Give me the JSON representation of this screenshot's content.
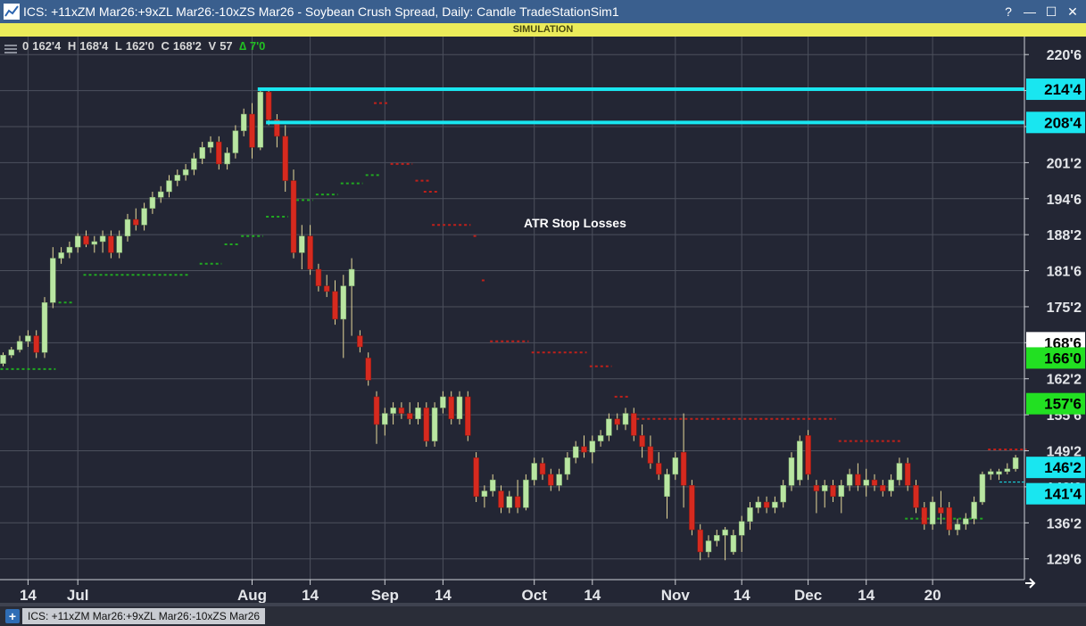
{
  "window": {
    "title": "ICS: +11xZM Mar26:+9xZL Mar26:-10xZS Mar26 - Soybean Crush Spread, Daily: Candle TradeStationSim1",
    "help": "?",
    "minimize": "—",
    "maximize": "☐",
    "close": "✕"
  },
  "banner": {
    "text": "SIMULATION"
  },
  "status": {
    "o_label": "0",
    "o_val": "162'4",
    "h_label": "H",
    "h_val": "168'4",
    "l_label": "L",
    "l_val": "162'0",
    "c_label": "C",
    "c_val": "168'2",
    "v_label": "V",
    "v_val": "57",
    "delta": "∆ 7'0"
  },
  "annotation": "ATR Stop Losses",
  "tab": {
    "label": "ICS: +11xZM Mar26:+9xZL Mar26:-10xZS Mar26",
    "add": "+"
  },
  "colors": {
    "background": "#232634",
    "up": "#b9e6a2",
    "down": "#d62a1f",
    "wick": "#e6d99a",
    "cyan": "#19e6f0",
    "green_marker": "#22e022",
    "stop_long": "#21a821",
    "stop_short": "#c0201a",
    "grid": "#4c505d"
  },
  "chart_data": {
    "type": "candlestick",
    "title": "Soybean Crush Spread, Daily",
    "price_unit": "cents, eighths",
    "ylim": [
      126.0,
      224.0
    ],
    "y_ticks": [
      "129'6",
      "136'2",
      "142'6",
      "149'2",
      "155'6",
      "162'2",
      "168'6",
      "175'2",
      "181'6",
      "188'2",
      "194'6",
      "201'2",
      "207'6",
      "214'2",
      "220'6"
    ],
    "x_tick_labels": [
      {
        "label": "14",
        "bar": 3
      },
      {
        "label": "Jul",
        "bar": 9
      },
      {
        "label": "Aug",
        "bar": 30
      },
      {
        "label": "14",
        "bar": 37
      },
      {
        "label": "Sep",
        "bar": 46
      },
      {
        "label": "14",
        "bar": 53
      },
      {
        "label": "Oct",
        "bar": 64
      },
      {
        "label": "14",
        "bar": 71
      },
      {
        "label": "Nov",
        "bar": 81
      },
      {
        "label": "14",
        "bar": 89
      },
      {
        "label": "Dec",
        "bar": 97
      },
      {
        "label": "14",
        "bar": 104
      },
      {
        "label": "20",
        "bar": 112
      }
    ],
    "horizontal_lines": [
      {
        "value": 214.5,
        "label": "214'4",
        "from_bar": 31
      },
      {
        "value": 208.5,
        "label": "208'4",
        "from_bar": 32
      }
    ],
    "price_markers": [
      {
        "value": 168.75,
        "label": "168'6",
        "style": "white"
      },
      {
        "value": 166.0,
        "label": "166'0",
        "style": "green"
      },
      {
        "value": 157.75,
        "label": "157'6",
        "style": "green"
      },
      {
        "value": 146.25,
        "label": "146'2",
        "style": "cyan"
      },
      {
        "value": 141.5,
        "label": "141'4",
        "style": "cyan"
      }
    ],
    "candles": [
      {
        "o": 165.0,
        "h": 167.0,
        "l": 164.5,
        "c": 166.5
      },
      {
        "o": 166.5,
        "h": 168.0,
        "l": 166.0,
        "c": 167.5
      },
      {
        "o": 167.5,
        "h": 170.0,
        "l": 167.0,
        "c": 169.0
      },
      {
        "o": 169.0,
        "h": 171.0,
        "l": 168.0,
        "c": 170.0
      },
      {
        "o": 170.0,
        "h": 171.0,
        "l": 166.0,
        "c": 167.0
      },
      {
        "o": 167.0,
        "h": 177.0,
        "l": 166.0,
        "c": 176.0
      },
      {
        "o": 176.0,
        "h": 186.0,
        "l": 175.0,
        "c": 184.0
      },
      {
        "o": 184.0,
        "h": 186.0,
        "l": 183.0,
        "c": 185.0
      },
      {
        "o": 185.0,
        "h": 187.0,
        "l": 184.0,
        "c": 186.0
      },
      {
        "o": 186.0,
        "h": 188.5,
        "l": 185.0,
        "c": 188.0
      },
      {
        "o": 188.0,
        "h": 189.0,
        "l": 186.0,
        "c": 186.5
      },
      {
        "o": 186.5,
        "h": 188.0,
        "l": 185.0,
        "c": 187.0
      },
      {
        "o": 187.0,
        "h": 189.0,
        "l": 185.0,
        "c": 188.0
      },
      {
        "o": 188.0,
        "h": 189.0,
        "l": 184.0,
        "c": 185.0
      },
      {
        "o": 185.0,
        "h": 189.0,
        "l": 184.0,
        "c": 188.0
      },
      {
        "o": 188.0,
        "h": 192.0,
        "l": 187.0,
        "c": 191.0
      },
      {
        "o": 191.0,
        "h": 193.0,
        "l": 189.0,
        "c": 190.0
      },
      {
        "o": 190.0,
        "h": 194.0,
        "l": 189.0,
        "c": 193.0
      },
      {
        "o": 193.0,
        "h": 196.0,
        "l": 192.0,
        "c": 195.0
      },
      {
        "o": 195.0,
        "h": 197.0,
        "l": 194.0,
        "c": 196.0
      },
      {
        "o": 196.0,
        "h": 199.0,
        "l": 195.0,
        "c": 198.0
      },
      {
        "o": 198.0,
        "h": 200.0,
        "l": 197.0,
        "c": 199.0
      },
      {
        "o": 199.0,
        "h": 201.0,
        "l": 198.0,
        "c": 200.0
      },
      {
        "o": 200.0,
        "h": 203.0,
        "l": 199.0,
        "c": 202.0
      },
      {
        "o": 202.0,
        "h": 205.0,
        "l": 201.0,
        "c": 204.0
      },
      {
        "o": 204.0,
        "h": 206.0,
        "l": 203.0,
        "c": 205.0
      },
      {
        "o": 205.0,
        "h": 206.0,
        "l": 200.0,
        "c": 201.0
      },
      {
        "o": 201.0,
        "h": 204.0,
        "l": 200.0,
        "c": 203.0
      },
      {
        "o": 203.0,
        "h": 208.0,
        "l": 202.0,
        "c": 207.0
      },
      {
        "o": 207.0,
        "h": 211.0,
        "l": 206.0,
        "c": 210.0
      },
      {
        "o": 210.0,
        "h": 212.0,
        "l": 202.0,
        "c": 204.0
      },
      {
        "o": 204.0,
        "h": 214.5,
        "l": 203.5,
        "c": 214.0
      },
      {
        "o": 214.0,
        "h": 214.5,
        "l": 208.0,
        "c": 209.0
      },
      {
        "o": 209.0,
        "h": 210.0,
        "l": 204.0,
        "c": 206.0
      },
      {
        "o": 206.0,
        "h": 208.0,
        "l": 196.0,
        "c": 198.0
      },
      {
        "o": 198.0,
        "h": 200.0,
        "l": 184.0,
        "c": 185.0
      },
      {
        "o": 185.0,
        "h": 190.0,
        "l": 182.0,
        "c": 188.0
      },
      {
        "o": 188.0,
        "h": 190.0,
        "l": 181.0,
        "c": 182.0
      },
      {
        "o": 182.0,
        "h": 183.0,
        "l": 178.0,
        "c": 179.0
      },
      {
        "o": 179.0,
        "h": 181.0,
        "l": 177.0,
        "c": 178.0
      },
      {
        "o": 178.0,
        "h": 180.0,
        "l": 172.0,
        "c": 173.0
      },
      {
        "o": 173.0,
        "h": 181.0,
        "l": 166.0,
        "c": 179.0
      },
      {
        "o": 179.0,
        "h": 184.0,
        "l": 170.0,
        "c": 182.0
      },
      {
        "o": 170.0,
        "h": 171.0,
        "l": 167.0,
        "c": 168.0
      },
      {
        "o": 166.0,
        "h": 167.0,
        "l": 161.0,
        "c": 162.0
      },
      {
        "o": 159.0,
        "h": 160.0,
        "l": 150.5,
        "c": 154.0
      },
      {
        "o": 154.0,
        "h": 157.0,
        "l": 152.0,
        "c": 156.0
      },
      {
        "o": 156.0,
        "h": 158.0,
        "l": 154.0,
        "c": 157.0
      },
      {
        "o": 157.0,
        "h": 158.0,
        "l": 155.0,
        "c": 156.0
      },
      {
        "o": 156.0,
        "h": 158.0,
        "l": 154.0,
        "c": 155.0
      },
      {
        "o": 155.0,
        "h": 158.0,
        "l": 154.0,
        "c": 157.0
      },
      {
        "o": 157.0,
        "h": 158.0,
        "l": 150.0,
        "c": 151.0
      },
      {
        "o": 151.0,
        "h": 158.0,
        "l": 150.0,
        "c": 157.0
      },
      {
        "o": 157.0,
        "h": 160.0,
        "l": 156.0,
        "c": 159.0
      },
      {
        "o": 159.0,
        "h": 160.0,
        "l": 154.0,
        "c": 155.0
      },
      {
        "o": 155.0,
        "h": 160.0,
        "l": 154.0,
        "c": 159.0
      },
      {
        "o": 159.0,
        "h": 160.0,
        "l": 151.0,
        "c": 152.0
      },
      {
        "o": 148.0,
        "h": 149.0,
        "l": 140.0,
        "c": 141.0
      },
      {
        "o": 141.0,
        "h": 143.0,
        "l": 139.0,
        "c": 142.0
      },
      {
        "o": 142.0,
        "h": 145.0,
        "l": 141.0,
        "c": 144.0
      },
      {
        "o": 142.0,
        "h": 143.0,
        "l": 138.0,
        "c": 139.0
      },
      {
        "o": 139.0,
        "h": 142.0,
        "l": 138.0,
        "c": 141.0
      },
      {
        "o": 141.0,
        "h": 144.0,
        "l": 138.0,
        "c": 139.0
      },
      {
        "o": 139.0,
        "h": 145.0,
        "l": 138.5,
        "c": 144.0
      },
      {
        "o": 144.0,
        "h": 148.0,
        "l": 143.0,
        "c": 147.0
      },
      {
        "o": 147.0,
        "h": 148.0,
        "l": 144.0,
        "c": 145.0
      },
      {
        "o": 145.0,
        "h": 146.0,
        "l": 142.0,
        "c": 143.0
      },
      {
        "o": 143.0,
        "h": 146.0,
        "l": 142.0,
        "c": 145.0
      },
      {
        "o": 145.0,
        "h": 149.0,
        "l": 144.0,
        "c": 148.0
      },
      {
        "o": 148.0,
        "h": 151.0,
        "l": 147.0,
        "c": 150.0
      },
      {
        "o": 150.0,
        "h": 152.0,
        "l": 148.0,
        "c": 149.0
      },
      {
        "o": 149.0,
        "h": 152.0,
        "l": 147.0,
        "c": 151.0
      },
      {
        "o": 151.0,
        "h": 153.0,
        "l": 150.0,
        "c": 152.0
      },
      {
        "o": 152.0,
        "h": 156.0,
        "l": 151.0,
        "c": 155.0
      },
      {
        "o": 155.0,
        "h": 156.0,
        "l": 153.0,
        "c": 154.0
      },
      {
        "o": 154.0,
        "h": 157.0,
        "l": 153.0,
        "c": 156.0
      },
      {
        "o": 156.0,
        "h": 157.0,
        "l": 151.0,
        "c": 152.0
      },
      {
        "o": 152.0,
        "h": 154.0,
        "l": 148.0,
        "c": 150.0
      },
      {
        "o": 150.0,
        "h": 152.0,
        "l": 146.0,
        "c": 147.0
      },
      {
        "o": 147.0,
        "h": 149.0,
        "l": 144.0,
        "c": 145.0
      },
      {
        "o": 141.0,
        "h": 146.0,
        "l": 137.0,
        "c": 145.0
      },
      {
        "o": 145.0,
        "h": 149.0,
        "l": 144.0,
        "c": 148.0
      },
      {
        "o": 149.0,
        "h": 156.0,
        "l": 139.0,
        "c": 143.0
      },
      {
        "o": 143.0,
        "h": 144.0,
        "l": 134.0,
        "c": 135.0
      },
      {
        "o": 135.0,
        "h": 136.0,
        "l": 129.5,
        "c": 131.0
      },
      {
        "o": 131.0,
        "h": 134.0,
        "l": 130.0,
        "c": 133.0
      },
      {
        "o": 133.0,
        "h": 135.0,
        "l": 132.0,
        "c": 134.0
      },
      {
        "o": 134.0,
        "h": 135.5,
        "l": 129.5,
        "c": 135.0
      },
      {
        "o": 131.0,
        "h": 135.0,
        "l": 130.5,
        "c": 134.0
      },
      {
        "o": 134.0,
        "h": 137.5,
        "l": 131.0,
        "c": 136.5
      },
      {
        "o": 136.5,
        "h": 140.0,
        "l": 135.0,
        "c": 139.0
      },
      {
        "o": 139.0,
        "h": 141.0,
        "l": 138.0,
        "c": 140.0
      },
      {
        "o": 140.0,
        "h": 141.0,
        "l": 138.0,
        "c": 139.0
      },
      {
        "o": 139.0,
        "h": 141.0,
        "l": 138.0,
        "c": 140.0
      },
      {
        "o": 140.0,
        "h": 144.0,
        "l": 139.0,
        "c": 143.0
      },
      {
        "o": 143.0,
        "h": 149.0,
        "l": 142.0,
        "c": 148.0
      },
      {
        "o": 144.0,
        "h": 152.0,
        "l": 143.0,
        "c": 151.0
      },
      {
        "o": 152.0,
        "h": 153.0,
        "l": 144.0,
        "c": 145.0
      },
      {
        "o": 143.0,
        "h": 144.0,
        "l": 138.0,
        "c": 142.0
      },
      {
        "o": 142.0,
        "h": 144.0,
        "l": 139.0,
        "c": 143.0
      },
      {
        "o": 143.0,
        "h": 144.0,
        "l": 140.0,
        "c": 141.0
      },
      {
        "o": 141.0,
        "h": 144.0,
        "l": 138.0,
        "c": 143.0
      },
      {
        "o": 143.0,
        "h": 146.0,
        "l": 142.0,
        "c": 145.0
      },
      {
        "o": 145.0,
        "h": 147.0,
        "l": 142.0,
        "c": 143.0
      },
      {
        "o": 143.0,
        "h": 146.0,
        "l": 141.0,
        "c": 144.0
      },
      {
        "o": 144.0,
        "h": 145.0,
        "l": 142.0,
        "c": 143.0
      },
      {
        "o": 143.0,
        "h": 144.0,
        "l": 141.0,
        "c": 142.0
      },
      {
        "o": 142.0,
        "h": 145.0,
        "l": 141.0,
        "c": 144.0
      },
      {
        "o": 144.0,
        "h": 148.0,
        "l": 143.0,
        "c": 147.0
      },
      {
        "o": 147.0,
        "h": 148.0,
        "l": 142.0,
        "c": 143.0
      },
      {
        "o": 143.0,
        "h": 144.0,
        "l": 138.0,
        "c": 139.0
      },
      {
        "o": 139.0,
        "h": 140.0,
        "l": 135.0,
        "c": 136.0
      },
      {
        "o": 136.0,
        "h": 141.0,
        "l": 135.0,
        "c": 140.0
      },
      {
        "o": 139.0,
        "h": 142.0,
        "l": 136.0,
        "c": 138.0
      },
      {
        "o": 139.0,
        "h": 140.0,
        "l": 134.0,
        "c": 135.0
      },
      {
        "o": 135.0,
        "h": 137.0,
        "l": 134.0,
        "c": 136.0
      },
      {
        "o": 136.0,
        "h": 138.0,
        "l": 135.0,
        "c": 137.0
      },
      {
        "o": 137.0,
        "h": 141.0,
        "l": 136.0,
        "c": 140.0
      },
      {
        "o": 140.0,
        "h": 145.5,
        "l": 139.5,
        "c": 145.0
      },
      {
        "o": 145.0,
        "h": 146.0,
        "l": 144.0,
        "c": 145.5
      },
      {
        "o": 145.0,
        "h": 146.0,
        "l": 144.0,
        "c": 145.5
      },
      {
        "o": 145.5,
        "h": 147.0,
        "l": 145.0,
        "c": 146.0
      },
      {
        "o": 146.0,
        "h": 148.5,
        "l": 145.5,
        "c": 148.0
      }
    ],
    "stop_segments": [
      {
        "side": "long",
        "from": 0,
        "to": 6,
        "value": 164.0
      },
      {
        "side": "long",
        "from": 7,
        "to": 8,
        "value": 176.0
      },
      {
        "side": "long",
        "from": 10,
        "to": 22,
        "value": 181.0
      },
      {
        "side": "long",
        "from": 24,
        "to": 26,
        "value": 183.0
      },
      {
        "side": "long",
        "from": 27,
        "to": 28,
        "value": 186.5
      },
      {
        "side": "long",
        "from": 29,
        "to": 31,
        "value": 188.0
      },
      {
        "side": "long",
        "from": 32,
        "to": 34,
        "value": 191.5
      },
      {
        "side": "long",
        "from": 35,
        "to": 37,
        "value": 194.5
      },
      {
        "side": "long",
        "from": 38,
        "to": 40,
        "value": 195.5
      },
      {
        "side": "long",
        "from": 41,
        "to": 43,
        "value": 197.5
      },
      {
        "side": "long",
        "from": 44,
        "to": 45,
        "value": 199.0
      },
      {
        "side": "short",
        "from": 45,
        "to": 46,
        "value": 212.0
      },
      {
        "side": "short",
        "from": 47,
        "to": 49,
        "value": 201.0
      },
      {
        "side": "short",
        "from": 50,
        "to": 51,
        "value": 198.0
      },
      {
        "side": "short",
        "from": 51,
        "to": 52,
        "value": 196.0
      },
      {
        "side": "short",
        "from": 52,
        "to": 56,
        "value": 190.0
      },
      {
        "side": "short",
        "from": 57,
        "to": 57,
        "value": 188.0
      },
      {
        "side": "short",
        "from": 58,
        "to": 58,
        "value": 180.0
      },
      {
        "side": "short",
        "from": 59,
        "to": 63,
        "value": 169.0
      },
      {
        "side": "short",
        "from": 64,
        "to": 70,
        "value": 167.0
      },
      {
        "side": "short",
        "from": 71,
        "to": 73,
        "value": 164.5
      },
      {
        "side": "short",
        "from": 74,
        "to": 75,
        "value": 159.0
      },
      {
        "side": "short",
        "from": 76,
        "to": 100,
        "value": 155.0
      },
      {
        "side": "short",
        "from": 101,
        "to": 108,
        "value": 151.0
      },
      {
        "side": "long",
        "from": 109,
        "to": 118,
        "value": 137.0
      },
      {
        "side": "short",
        "from": 119,
        "to": 123,
        "value": 149.5
      }
    ]
  }
}
